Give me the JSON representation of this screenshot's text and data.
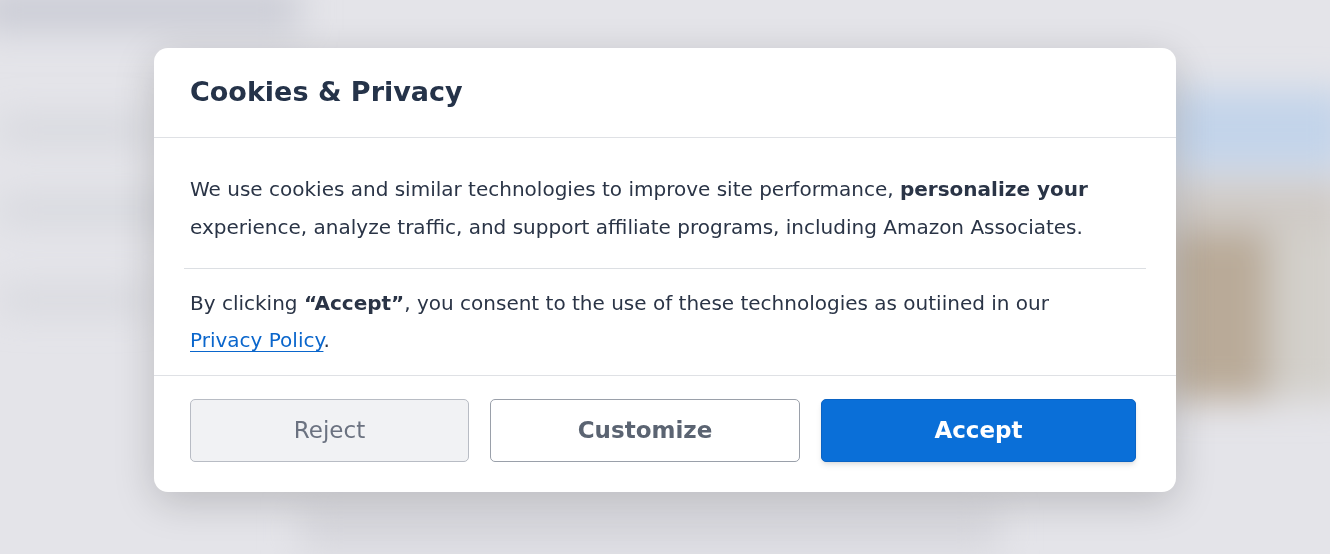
{
  "dialog": {
    "title": "Cookies & Privacy",
    "intro": "We use cookies and similar technologies to improve site performance, **personalize your** experience, analyze traffic, and support affiliate programs, including Amazon Associates.",
    "consent": {
      "text": "By clicking **“Accept”**, you consent to the use of these technologies as outiined in our",
      "link": "Privacy Policy",
      "after": "."
    },
    "buttons": [
      {
        "label": "Reject",
        "kind": "muted"
      },
      {
        "label": "Customize",
        "kind": "outline"
      },
      {
        "label": "Accept",
        "kind": "primary"
      }
    ]
  }
}
